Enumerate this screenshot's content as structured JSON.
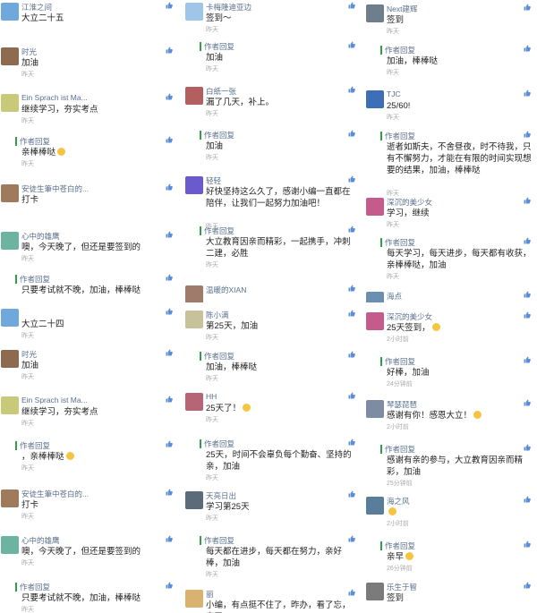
{
  "panels": [
    {
      "id": "col1-top",
      "entries": [
        {
          "kind": "user",
          "name": "江淮之间",
          "text": "大立二十五",
          "time": "",
          "avatar": "#6fa8dc"
        },
        {
          "kind": "user",
          "name": "时光",
          "text": "加油",
          "time": "昨天",
          "avatar": "#8e6b4e"
        },
        {
          "kind": "user",
          "name": "Ein Sprach ist Ma...",
          "text": "继续学习，夯实考点",
          "time": "昨天",
          "avatar": "#c9c97a"
        },
        {
          "kind": "reply",
          "name": "作者回复",
          "text": "亲棒棒哒",
          "time": "昨天",
          "emoji": true
        },
        {
          "kind": "user",
          "name": "安徒生筆中苍白的...",
          "text": "打卡",
          "time": "",
          "avatar": "#a07b5b"
        },
        {
          "kind": "user",
          "name": "心中的雄鹰",
          "text": "噢，今天晚了，但还是要签到的",
          "time": "昨天",
          "avatar": "#6cb3a0"
        },
        {
          "kind": "reply",
          "name": "作者回复",
          "text": "只要考试就不晚，加油，棒棒哒",
          "time": ""
        }
      ]
    },
    {
      "id": "col1-bottom",
      "entries": [
        {
          "kind": "user",
          "name": "",
          "text": "大立二十四",
          "time": "昨天",
          "avatar": "#6fa8dc"
        },
        {
          "kind": "user",
          "name": "时光",
          "text": "加油",
          "time": "昨天",
          "avatar": "#8e6b4e"
        },
        {
          "kind": "user",
          "name": "Ein Sprach ist Ma...",
          "text": "继续学习，夯实考点",
          "time": "昨天",
          "avatar": "#c9c97a"
        },
        {
          "kind": "reply",
          "name": "作者回复",
          "text": "，亲棒棒哒",
          "time": "昨天",
          "emoji": true
        },
        {
          "kind": "user",
          "name": "安徒生筆中苍白的...",
          "text": "打卡",
          "time": "昨天",
          "avatar": "#a07b5b"
        },
        {
          "kind": "user",
          "name": "心中的雄鹰",
          "text": "噢，今天晚了，但还是要签到的",
          "time": "昨天",
          "avatar": "#6cb3a0"
        },
        {
          "kind": "reply",
          "name": "作者回复",
          "text": "只要考试就不晚，加油，棒棒哒",
          "time": "昨天"
        }
      ]
    },
    {
      "id": "col2-top",
      "entries": [
        {
          "kind": "user",
          "name": "卡梅隆迪亚边",
          "text": "签到～",
          "time": "昨天",
          "avatar": "#9fc5e8"
        },
        {
          "kind": "reply",
          "name": "作者回复",
          "text": "加油",
          "time": "昨天"
        },
        {
          "kind": "user",
          "name": "白纸一张",
          "text": "漏了几天，补上。",
          "time": "昨天",
          "avatar": "#b45f5f"
        },
        {
          "kind": "reply",
          "name": "作者回复",
          "text": "加油",
          "time": "昨天"
        },
        {
          "kind": "user",
          "name": "轻轻",
          "text": "好快坚持这么久了，感谢小编一直都在陪伴，让我们一起努力加油吧！",
          "time": "昨天",
          "avatar": "#6a5acd"
        },
        {
          "kind": "reply",
          "name": "作者回复",
          "text": "大立教育因亲而精彩，一起携手，冲刺二建，必胜",
          "time": "昨天"
        },
        {
          "kind": "user",
          "name": "温暖的XIAN",
          "text": "",
          "time": "",
          "avatar": "#9e7b6a"
        }
      ]
    },
    {
      "id": "col2-bottom",
      "entries": [
        {
          "kind": "user",
          "name": "陈小满",
          "text": "第25天，加油",
          "time": "昨天",
          "avatar": "#c7c29a"
        },
        {
          "kind": "reply",
          "name": "作者回复",
          "text": "加油，棒棒哒",
          "time": "昨天"
        },
        {
          "kind": "user",
          "name": "HH",
          "text": "25天了！",
          "time": "昨天",
          "avatar": "#b56576",
          "emoji": true
        },
        {
          "kind": "reply",
          "name": "作者回复",
          "text": "25天，时间不会辜负每个勤奋、坚持的亲，加油",
          "time": "昨天"
        },
        {
          "kind": "user",
          "name": "天亮日出",
          "text": "学习第25天",
          "time": "昨天",
          "avatar": "#5b6b7a"
        },
        {
          "kind": "reply",
          "name": "作者回复",
          "text": "每天都在进步，每天都在努力，亲好棒，加油",
          "time": "昨天"
        },
        {
          "kind": "user",
          "name": "丽",
          "text": "小编，有点挺不住了，昨办，看了忘，忘了",
          "time": "",
          "avatar": "#d9b26f"
        }
      ]
    },
    {
      "id": "col3-top",
      "entries": [
        {
          "kind": "user",
          "name": "Next建辉",
          "text": "签到",
          "time": "昨天",
          "avatar": "#6d7f8d"
        },
        {
          "kind": "reply",
          "name": "作者回复",
          "text": "加油，棒棒哒",
          "time": "昨天"
        },
        {
          "kind": "user",
          "name": "TJC",
          "text": "25/60!",
          "time": "昨天",
          "avatar": "#3d6fb6"
        },
        {
          "kind": "reply",
          "name": "作者回复",
          "text": "逝者如斯夫，不舍昼夜，时不待我，只有不懈努力，才能在有限的时间实现想要的结果，加油，棒棒哒",
          "time": "昨天"
        },
        {
          "kind": "user",
          "name": "深沉的美少女",
          "text": "学习，继续",
          "time": "昨天",
          "avatar": "#c45b8a"
        },
        {
          "kind": "reply",
          "name": "作者回复",
          "text": "每天学习，每天进步，每天都有收获，亲棒棒哒，加油",
          "time": "昨天"
        },
        {
          "kind": "user",
          "name": "海点",
          "text": "",
          "time": "",
          "avatar": "#6a8fb0"
        }
      ]
    },
    {
      "id": "col3-bottom",
      "entries": [
        {
          "kind": "user",
          "name": "深沉的美少女",
          "text": "25天签到，",
          "time": "2小时前",
          "avatar": "#c45b8a",
          "emoji": true
        },
        {
          "kind": "reply",
          "name": "作者回复",
          "text": "好棒，加油",
          "time": "24分钟前"
        },
        {
          "kind": "user",
          "name": "琴瑟琵琶",
          "text": "感谢有你！感恩大立！",
          "time": "2小时前",
          "avatar": "#7d8ba3",
          "emoji": true
        },
        {
          "kind": "reply",
          "name": "作者回复",
          "text": "感谢有亲的参与，大立教育因亲而精彩，加油",
          "time": "25分钟前"
        },
        {
          "kind": "user",
          "name": "海之风",
          "text": "",
          "time": "2小时前",
          "avatar": "#5a7d9a",
          "emoji": true
        },
        {
          "kind": "reply",
          "name": "作者回复",
          "text": "亲早",
          "time": "26分钟前",
          "emoji": true
        },
        {
          "kind": "user",
          "name": "乐生于智",
          "text": "签到",
          "time": "",
          "avatar": "#7b7b7b"
        }
      ]
    }
  ]
}
